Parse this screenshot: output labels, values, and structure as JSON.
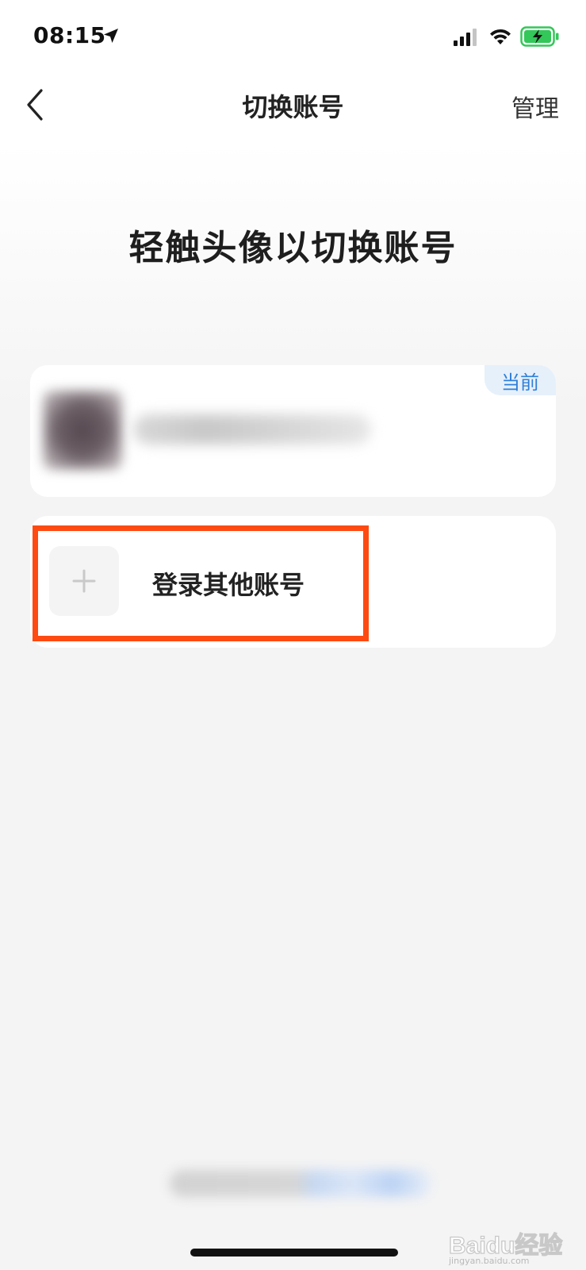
{
  "status_bar": {
    "time": "08:15",
    "icons": [
      "location-arrow-icon",
      "cellular-signal-icon",
      "wifi-icon",
      "battery-charging-icon"
    ],
    "battery_color": "#34c759"
  },
  "nav": {
    "title": "切换账号",
    "manage_label": "管理",
    "back_icon": "chevron-left-icon"
  },
  "heading": "轻触头像以切换账号",
  "current_account": {
    "badge": "当前",
    "badge_color": "#2f7fd8",
    "avatar": "blurred",
    "name": "blurred"
  },
  "add_account": {
    "label": "登录其他账号",
    "icon": "plus-icon"
  },
  "highlight": {
    "color": "#ff4a12",
    "target": "add-account-row"
  },
  "watermark": {
    "text": "Baidu经验",
    "subtext": "jingyan.baidu.com"
  }
}
